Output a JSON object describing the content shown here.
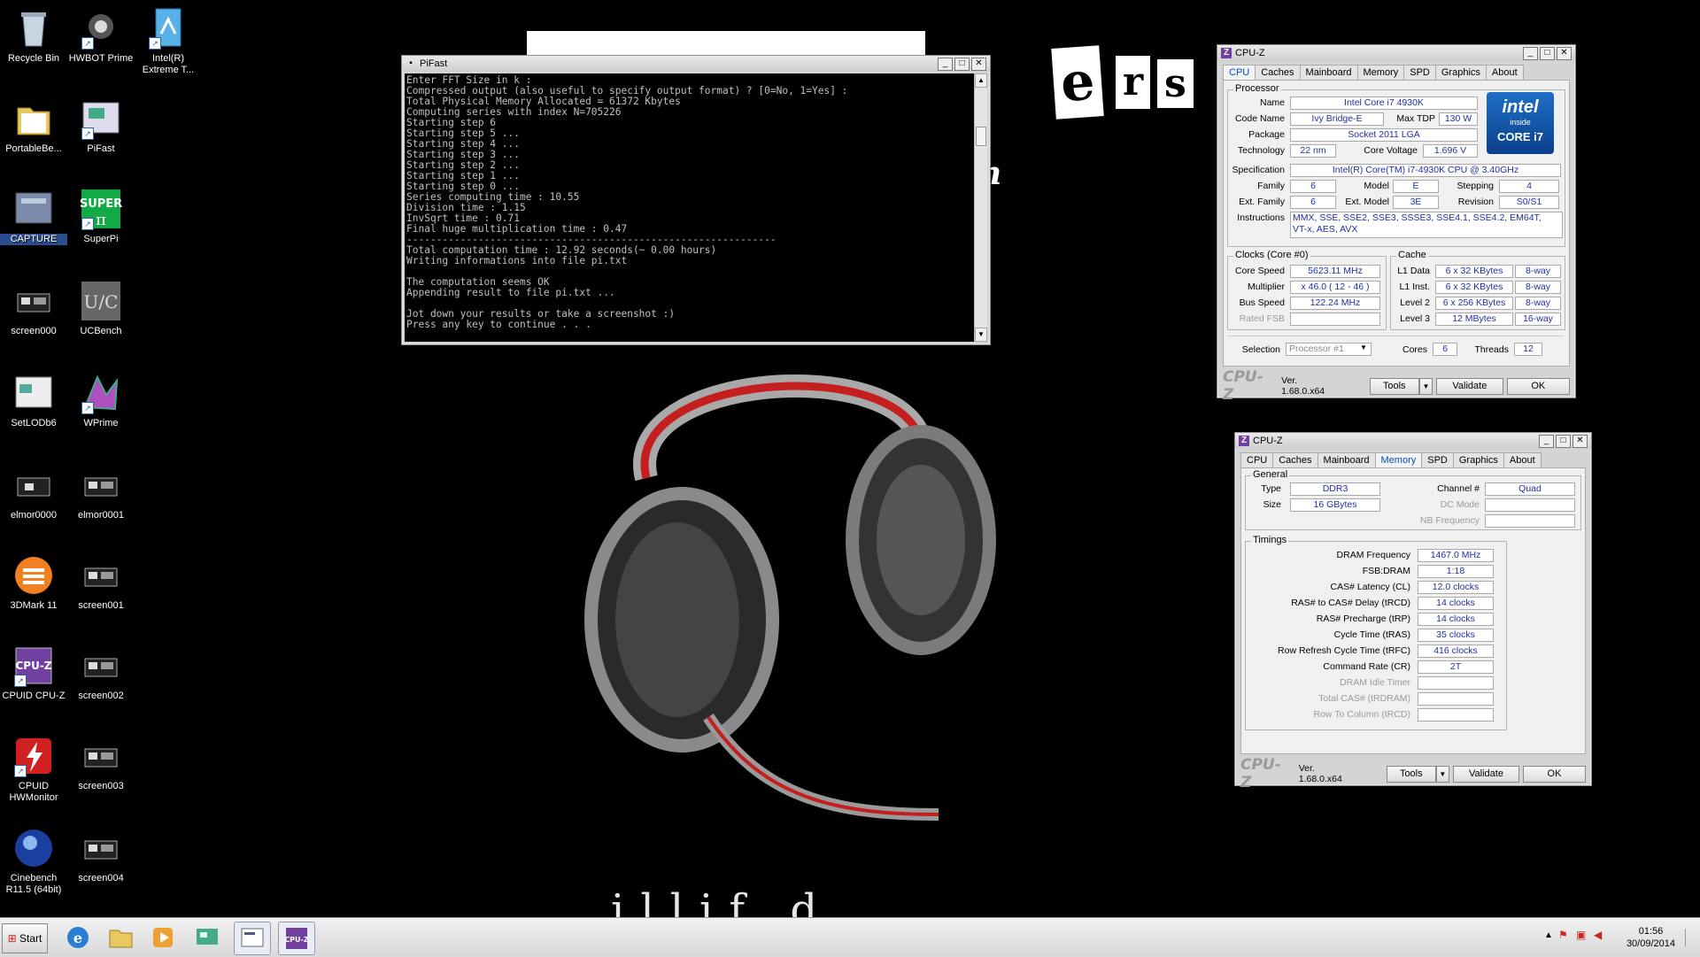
{
  "wallpaper": {
    "letters": [
      "e",
      "r",
      "s"
    ],
    "script": "n",
    "bottom_text": "illif          d"
  },
  "desktop_icons": [
    {
      "label": "Recycle Bin",
      "icon": "recycle-bin-icon"
    },
    {
      "label": "HWBOT Prime",
      "icon": "hwbot-icon"
    },
    {
      "label": "Intel(R) Extreme T...",
      "icon": "intel-xtu-icon"
    },
    {
      "label": "PortableBe...",
      "icon": "folder-icon"
    },
    {
      "label": "PiFast",
      "icon": "pifast-icon"
    },
    {
      "label": "CAPTURE",
      "icon": "capture-icon"
    },
    {
      "label": "SuperPi",
      "icon": "superpi-icon"
    },
    {
      "label": "screen000",
      "icon": "screenshot-file-icon"
    },
    {
      "label": "UCBench",
      "icon": "ucbench-icon"
    },
    {
      "label": "SetLODb6",
      "icon": "setlod-icon"
    },
    {
      "label": "WPrime",
      "icon": "wprime-icon"
    },
    {
      "label": "elmor0000",
      "icon": "screenshot-file-icon"
    },
    {
      "label": "elmor0001",
      "icon": "screenshot-file-icon"
    },
    {
      "label": "3DMark 11",
      "icon": "3dmark-icon"
    },
    {
      "label": "screen001",
      "icon": "screenshot-file-icon"
    },
    {
      "label": "CPUID CPU-Z",
      "icon": "cpuz-icon"
    },
    {
      "label": "screen002",
      "icon": "screenshot-file-icon"
    },
    {
      "label": "CPUID HWMonitor",
      "icon": "hwmonitor-icon"
    },
    {
      "label": "screen003",
      "icon": "screenshot-file-icon"
    },
    {
      "label": "Cinebench R11.5 (64bit)",
      "icon": "cinebench-icon"
    },
    {
      "label": "screen004",
      "icon": "screenshot-file-icon"
    }
  ],
  "pifast": {
    "title": "PiFast",
    "console_lines": [
      "Enter FFT Size in k :",
      "Compressed output (also useful to specify output format) ? [0=No, 1=Yes] :",
      "Total Physical Memory Allocated = 61372 Kbytes",
      "Computing series with index N=705226",
      "Starting step 6",
      "Starting step 5 ...",
      "Starting step 4 ...",
      "Starting step 3 ...",
      "Starting step 2 ...",
      "Starting step 1 ...",
      "Starting step 0 ...",
      "Series computing time : 10.55",
      "Division time : 1.15",
      "InvSqrt time : 0.71",
      "Final huge multiplication time : 0.47",
      "--------------------------------------------------------------",
      "Total computation time : 12.92 seconds(~ 0.00 hours)",
      "Writing informations into file pi.txt",
      "",
      "The computation seems OK",
      "Appending result to file pi.txt ...",
      "",
      "Jot down your results or take a screenshot :)",
      "Press any key to continue . . ."
    ]
  },
  "cpuz_cpu": {
    "title": "CPU-Z",
    "tabs": [
      "CPU",
      "Caches",
      "Mainboard",
      "Memory",
      "SPD",
      "Graphics",
      "About"
    ],
    "active_tab": "CPU",
    "processor_label": "Processor",
    "name_label": "Name",
    "name": "Intel Core i7 4930K",
    "codename_label": "Code Name",
    "codename": "Ivy Bridge-E",
    "maxtdp_label": "Max TDP",
    "maxtdp": "130 W",
    "package_label": "Package",
    "package": "Socket 2011 LGA",
    "technology_label": "Technology",
    "technology": "22 nm",
    "corevoltage_label": "Core Voltage",
    "corevoltage": "1.696 V",
    "spec_label": "Specification",
    "spec": "Intel(R) Core(TM) i7-4930K CPU @ 3.40GHz",
    "family_label": "Family",
    "family": "6",
    "model_label": "Model",
    "model": "E",
    "stepping_label": "Stepping",
    "stepping": "4",
    "extfamily_label": "Ext. Family",
    "extfamily": "6",
    "extmodel_label": "Ext. Model",
    "extmodel": "3E",
    "revision_label": "Revision",
    "revision": "S0/S1",
    "instructions_label": "Instructions",
    "instructions_1": "MMX, SSE, SSE2, SSE3, SSSE3, SSE4.1, SSE4.2, EM64T,",
    "instructions_2": "VT-x, AES, AVX",
    "intel_logo_text": "intel",
    "intel_inside": "inside",
    "intel_core": "CORE i7",
    "clocks_label": "Clocks (Core #0)",
    "corespeed_label": "Core Speed",
    "corespeed": "5623.11 MHz",
    "multiplier_label": "Multiplier",
    "multiplier": "x 46.0 ( 12 - 46 )",
    "busspeed_label": "Bus Speed",
    "busspeed": "122.24 MHz",
    "ratedfsb_label": "Rated FSB",
    "ratedfsb": "",
    "cache_label": "Cache",
    "l1d_label": "L1 Data",
    "l1d": "6 x 32 KBytes",
    "l1d_way": "8-way",
    "l1i_label": "L1 Inst.",
    "l1i": "6 x 32 KBytes",
    "l1i_way": "8-way",
    "l2_label": "Level 2",
    "l2": "6 x 256 KBytes",
    "l2_way": "8-way",
    "l3_label": "Level 3",
    "l3": "12 MBytes",
    "l3_way": "16-way",
    "selection_label": "Selection",
    "selection": "Processor #1",
    "cores_label": "Cores",
    "cores": "6",
    "threads_label": "Threads",
    "threads": "12",
    "brand": "CPU-Z",
    "version": "Ver. 1.68.0.x64",
    "tools": "Tools",
    "validate": "Validate",
    "ok": "OK"
  },
  "cpuz_mem": {
    "title": "CPU-Z",
    "tabs": [
      "CPU",
      "Caches",
      "Mainboard",
      "Memory",
      "SPD",
      "Graphics",
      "About"
    ],
    "active_tab": "Memory",
    "general_label": "General",
    "type_label": "Type",
    "type": "DDR3",
    "size_label": "Size",
    "size": "16 GBytes",
    "channel_label": "Channel #",
    "channel": "Quad",
    "dcmode_label": "DC Mode",
    "dcmode": "",
    "nbfreq_label": "NB Frequency",
    "nbfreq": "",
    "timings_label": "Timings",
    "timings": [
      {
        "label": "DRAM Frequency",
        "value": "1467.0 MHz",
        "disabled": false
      },
      {
        "label": "FSB:DRAM",
        "value": "1:18",
        "disabled": false
      },
      {
        "label": "CAS# Latency (CL)",
        "value": "12.0 clocks",
        "disabled": false
      },
      {
        "label": "RAS# to CAS# Delay (tRCD)",
        "value": "14 clocks",
        "disabled": false
      },
      {
        "label": "RAS# Precharge (tRP)",
        "value": "14 clocks",
        "disabled": false
      },
      {
        "label": "Cycle Time (tRAS)",
        "value": "35 clocks",
        "disabled": false
      },
      {
        "label": "Row Refresh Cycle Time (tRFC)",
        "value": "416 clocks",
        "disabled": false
      },
      {
        "label": "Command Rate (CR)",
        "value": "2T",
        "disabled": false
      },
      {
        "label": "DRAM Idle Timer",
        "value": "",
        "disabled": true
      },
      {
        "label": "Total CAS# (tRDRAM)",
        "value": "",
        "disabled": true
      },
      {
        "label": "Row To Column (tRCD)",
        "value": "",
        "disabled": true
      }
    ],
    "brand": "CPU-Z",
    "version": "Ver. 1.68.0.x64",
    "tools": "Tools",
    "validate": "Validate",
    "ok": "OK"
  },
  "taskbar": {
    "start": "Start",
    "apps": [
      "ie-icon",
      "explorer-icon",
      "media-player-icon",
      "network-tool-icon",
      "capture-app-icon",
      "cpuz-app-icon"
    ],
    "time": "01:56",
    "date": "30/09/2014"
  }
}
